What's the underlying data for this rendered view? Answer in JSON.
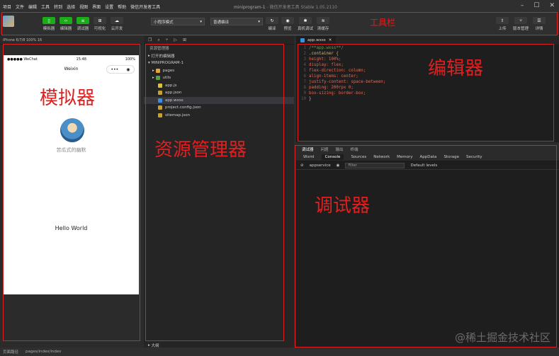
{
  "menubar": {
    "items": [
      "项目",
      "文件",
      "编辑",
      "工具",
      "转到",
      "选择",
      "视图",
      "界面",
      "设置",
      "帮助",
      "微信开发者工具"
    ],
    "title": "miniprogram-1",
    "title_suffix": " - 微信开发者工具 Stable 1.05.2110"
  },
  "toolbar": {
    "buttons": [
      {
        "label": "模拟器",
        "icon": "phone-icon"
      },
      {
        "label": "编辑器",
        "icon": "code-icon"
      },
      {
        "label": "调试器",
        "icon": "debug-icon"
      },
      {
        "label": "可视化",
        "icon": "visual-icon"
      },
      {
        "label": "云开发",
        "icon": "cloud-icon"
      }
    ],
    "mode_select": "小程序模式",
    "compile_select": "普通编译",
    "actions": [
      "编译",
      "预览",
      "真机调试",
      "清缓存"
    ],
    "right_actions": [
      "上传",
      "版本管理",
      "详情"
    ]
  },
  "simulator": {
    "device": "iPhone 6/7/8 100% 16",
    "status_left": "●●●●● WeChat",
    "status_time": "15:48",
    "status_right": "100%",
    "nav_title": "Weixin",
    "nickname": "苦瓜式的幽默",
    "hello": "Hello World"
  },
  "explorer": {
    "header": "资源管理器",
    "open_editors": "打开的编辑器",
    "project": "MINIPROGRAM-1",
    "files": [
      {
        "name": "pages",
        "type": "folder"
      },
      {
        "name": "utils",
        "type": "folder"
      },
      {
        "name": "app.js",
        "type": "js"
      },
      {
        "name": "app.json",
        "type": "json"
      },
      {
        "name": "app.wxss",
        "type": "wxss",
        "selected": true
      },
      {
        "name": "project.config.json",
        "type": "json"
      },
      {
        "name": "sitemap.json",
        "type": "json"
      }
    ],
    "outline": "大纲"
  },
  "editor": {
    "tab": "app.wxss",
    "lines": [
      "/**app.wxss**/",
      ".container {",
      "  height: 100%;",
      "  display: flex;",
      "  flex-direction: column;",
      "  align-items: center;",
      "  justify-content: space-between;",
      "  padding: 200rpx 0;",
      "  box-sizing: border-box;",
      "}"
    ]
  },
  "debugger": {
    "top_tabs": [
      "调试器",
      "问题",
      "输出",
      "终端"
    ],
    "tabs": [
      "Wxml",
      "Console",
      "Sources",
      "Network",
      "Memory",
      "AppData",
      "Storage",
      "Security"
    ],
    "active_tab": "Console",
    "context": "appservice",
    "filter_placeholder": "Filter",
    "levels": "Default levels"
  },
  "statusline": {
    "items": [
      "页面路径",
      "pages/index/index"
    ]
  },
  "annotations": {
    "toolbar": "工具栏",
    "editor": "编辑器",
    "simulator": "模拟器",
    "explorer": "资源管理器",
    "debugger": "调试器"
  },
  "watermark": "@稀土掘金技术社区",
  "colors": {
    "annotation": "#e02020",
    "accent_green": "#1aad19"
  }
}
